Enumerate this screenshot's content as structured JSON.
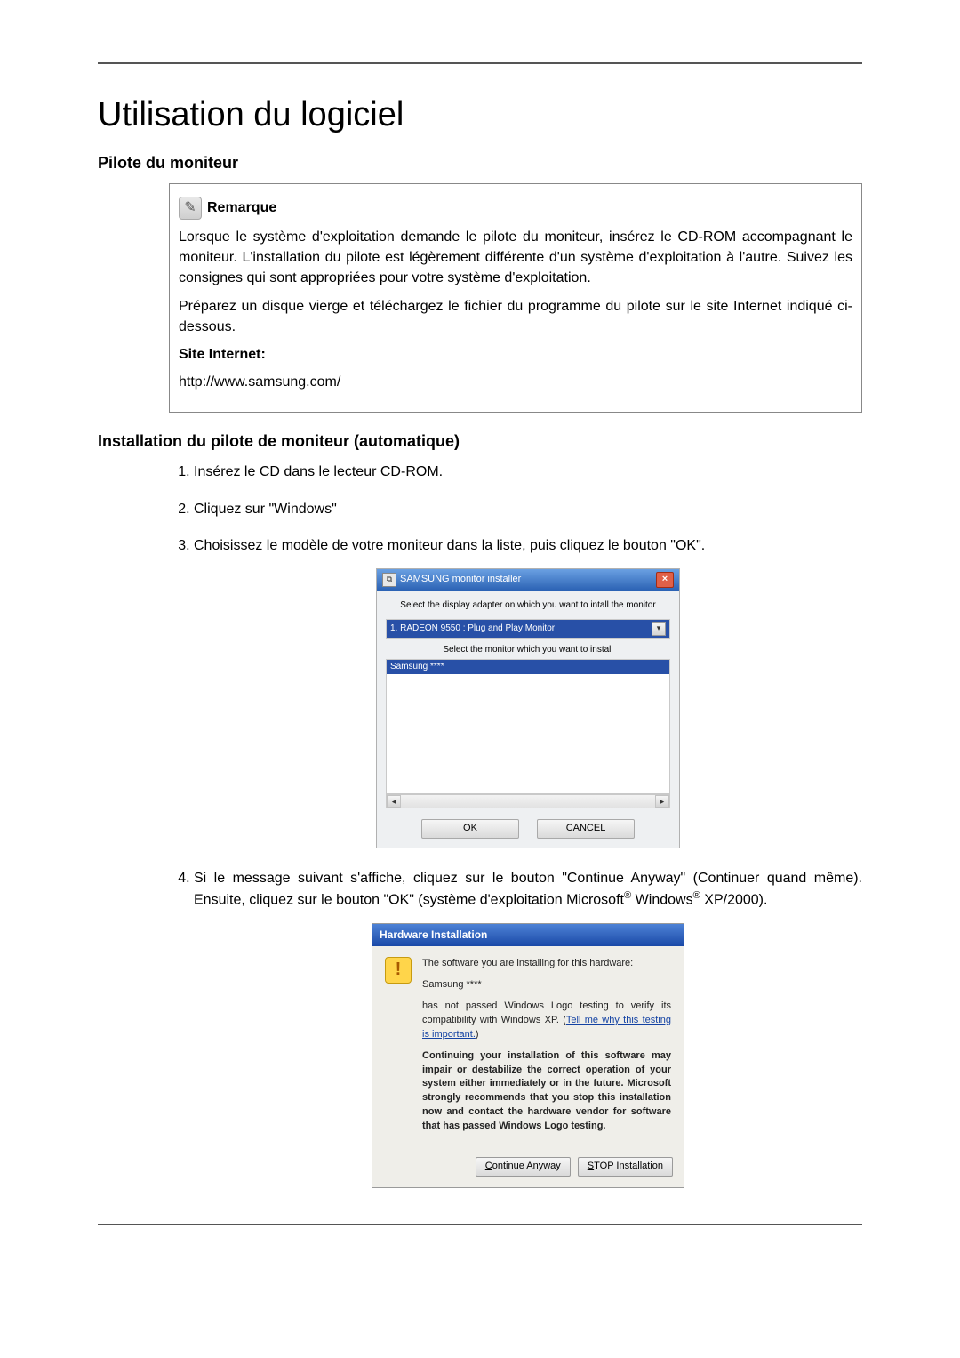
{
  "page": {
    "title": "Utilisation du logiciel",
    "section1": "Pilote du moniteur",
    "section2": "Installation du pilote de moniteur (automatique)"
  },
  "note": {
    "label": "Remarque",
    "p1": "Lorsque le système d'exploitation demande le pilote du moniteur, insérez le CD-ROM accompagnant le moniteur. L'installation du pilote est légèrement différente d'un système d'exploitation à l'autre. Suivez les consignes qui sont appropriées pour votre système d'exploitation.",
    "p2": "Préparez un disque vierge et téléchargez le fichier du programme du pilote sur le site Internet indiqué ci-dessous.",
    "site_label": "Site Internet:",
    "site_url": "http://www.samsung.com/"
  },
  "steps": {
    "s1": "Insérez le CD dans le lecteur CD-ROM.",
    "s2": "Cliquez sur \"Windows\"",
    "s3": "Choisissez le modèle de votre moniteur dans la liste, puis cliquez le bouton \"OK\".",
    "s4a": "Si le message suivant s'affiche, cliquez sur le bouton \"Continue Anyway\" (Continuer quand même). Ensuite, cliquez sur le bouton \"OK\" (système d'exploitation Microsoft",
    "s4b": " Windows",
    "s4c": " XP/2000)."
  },
  "installer": {
    "title": "SAMSUNG monitor installer",
    "label_adapter": "Select the display adapter on which you want to intall the monitor",
    "adapter_selected": "1. RADEON 9550 : Plug and Play Monitor",
    "label_monitor": "Select the monitor which you want to install",
    "monitor_selected": "Samsung ****",
    "ok": "OK",
    "cancel": "CANCEL"
  },
  "hw": {
    "title": "Hardware Installation",
    "line1": "The software you are installing for this hardware:",
    "line2": "Samsung ****",
    "line3a": "has not passed Windows Logo testing to verify its compatibility with Windows XP. (",
    "line3link": "Tell me why this testing is important.",
    "line3b": ")",
    "line4": "Continuing your installation of this software may impair or destabilize the correct operation of your system either immediately or in the future. Microsoft strongly recommends that you stop this installation now and contact the hardware vendor for software that has passed Windows Logo testing.",
    "btn_continue": "Continue Anyway",
    "btn_stop": "STOP Installation"
  }
}
